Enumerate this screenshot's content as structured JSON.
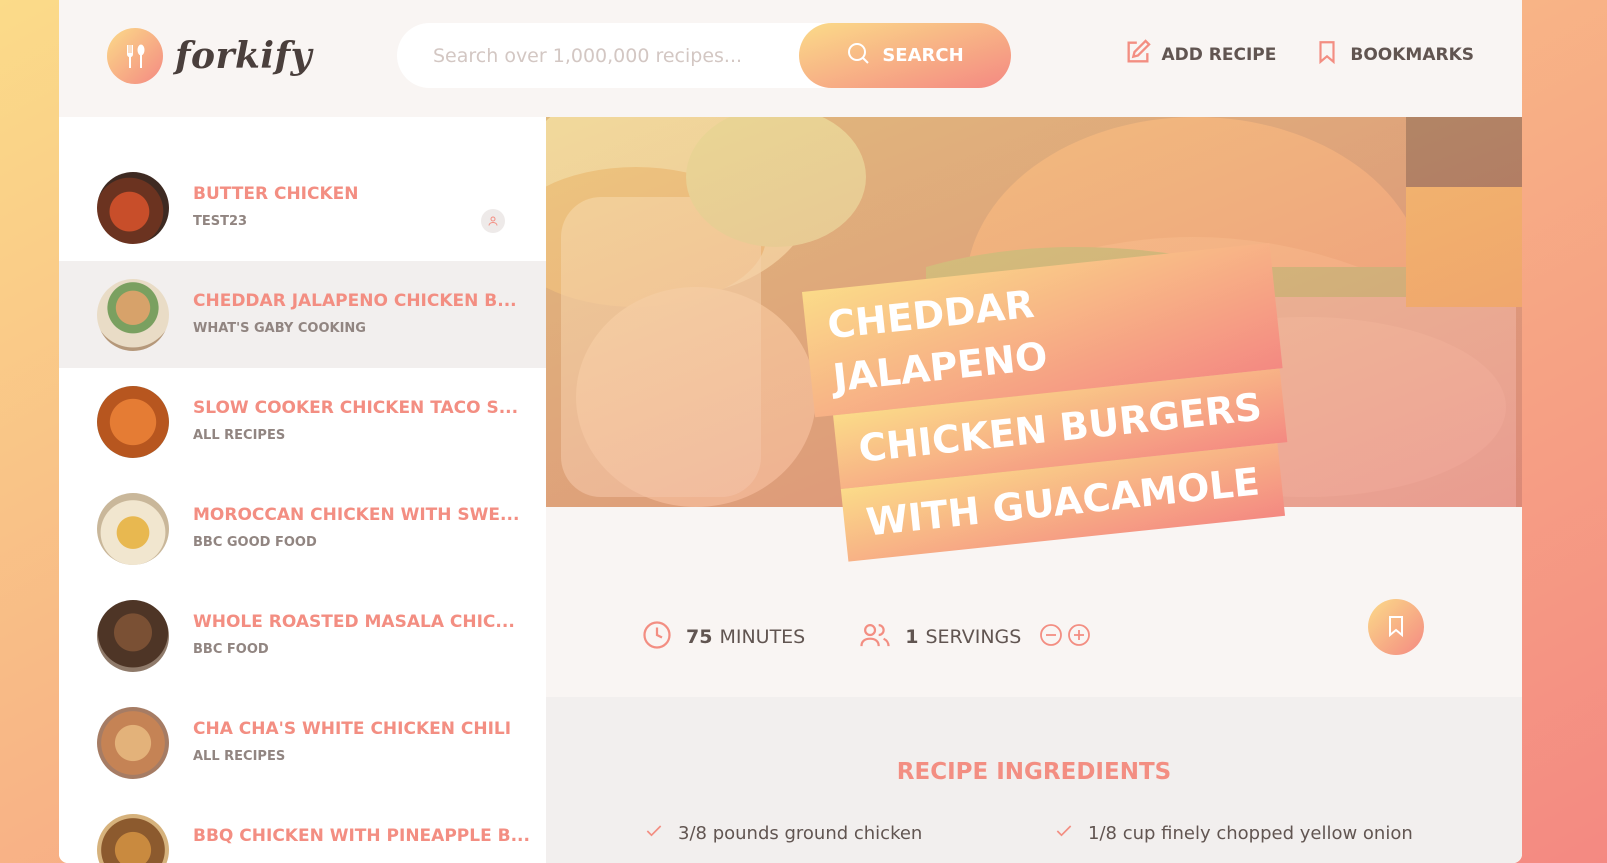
{
  "app": {
    "name": "forkify"
  },
  "search": {
    "placeholder": "Search over 1,000,000 recipes...",
    "button_label": "SEARCH"
  },
  "nav": {
    "add_recipe": "ADD RECIPE",
    "bookmarks": "BOOKMARKS"
  },
  "results": [
    {
      "title": "BUTTER CHICKEN",
      "publisher": "TEST23",
      "user_generated": true,
      "color": "#9c4a2e"
    },
    {
      "title": "CHEDDAR JALAPENO CHICKEN B...",
      "publisher": "WHAT'S GABY COOKING",
      "active": true,
      "color": "#c79a6d"
    },
    {
      "title": "SLOW COOKER CHICKEN TACO S...",
      "publisher": "ALL RECIPES",
      "color": "#d2702f"
    },
    {
      "title": "MOROCCAN CHICKEN WITH SWE...",
      "publisher": "BBC GOOD FOOD",
      "color": "#e3c47e"
    },
    {
      "title": "WHOLE ROASTED MASALA CHIC...",
      "publisher": "BBC FOOD",
      "color": "#6e4a35"
    },
    {
      "title": "CHA CHA'S WHITE CHICKEN CHILI",
      "publisher": "ALL RECIPES",
      "color": "#c9996c"
    },
    {
      "title": "BBQ CHICKEN WITH PINEAPPLE B...",
      "publisher": "",
      "color": "#b67a41"
    }
  ],
  "recipe": {
    "title_lines": [
      "CHEDDAR JALAPENO",
      "CHICKEN BURGERS",
      "WITH GUACAMOLE"
    ],
    "cooking_time": "75",
    "cooking_time_unit": "MINUTES",
    "servings": "1",
    "servings_unit": "SERVINGS",
    "ingredients_heading": "RECIPE INGREDIENTS",
    "ingredients": [
      "3/8 pounds ground chicken",
      "1/8 cup finely chopped yellow onion"
    ]
  },
  "colors": {
    "accent": "#f38e82",
    "gradient_start": "#fbdb89",
    "gradient_end": "#f48982"
  }
}
